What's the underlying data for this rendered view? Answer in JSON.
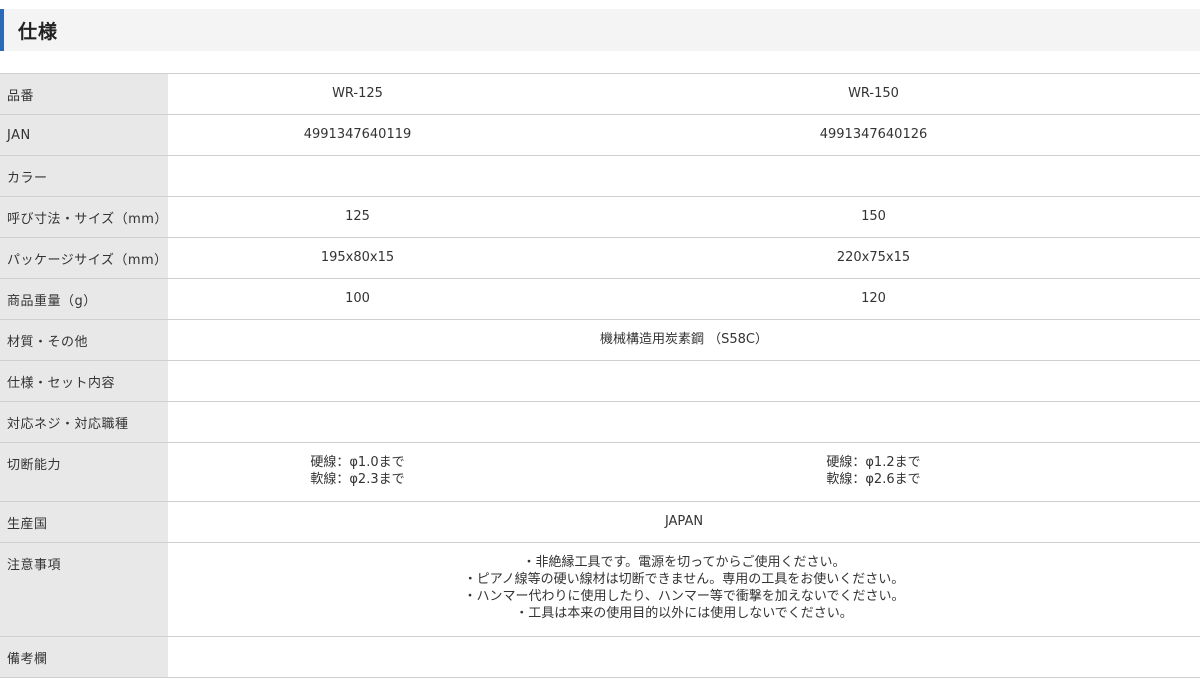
{
  "section": {
    "title": "仕様"
  },
  "columns": [
    "WR-125",
    "WR-150"
  ],
  "rows": {
    "model": {
      "label": "品番",
      "values": [
        "WR-125",
        "WR-150"
      ]
    },
    "jan": {
      "label": "JAN",
      "values": [
        "4991347640119",
        "4991347640126"
      ]
    },
    "color": {
      "label": "カラー",
      "values": [
        "",
        ""
      ]
    },
    "nominal_size": {
      "label": "呼び寸法・サイズ（mm）",
      "values": [
        "125",
        "150"
      ]
    },
    "package_size": {
      "label": "パッケージサイズ（mm）",
      "values": [
        "195x80x15",
        "220x75x15"
      ]
    },
    "weight": {
      "label": "商品重量（g）",
      "values": [
        "100",
        "120"
      ]
    },
    "material": {
      "label": "材質・その他",
      "value": "機械構造用炭素鋼 （S58C）"
    },
    "spec_set": {
      "label": "仕様・セット内容",
      "value": ""
    },
    "compat": {
      "label": "対応ネジ・対応職種",
      "value": ""
    },
    "cutting": {
      "label": "切断能力",
      "values": [
        [
          "硬線：φ1.0まで",
          "軟線：φ2.3まで"
        ],
        [
          "硬線：φ1.2まで",
          "軟線：φ2.6まで"
        ]
      ]
    },
    "origin": {
      "label": "生産国",
      "value": "JAPAN"
    },
    "cautions": {
      "label": "注意事項",
      "lines": [
        "・非絶縁工具です。電源を切ってからご使用ください。",
        "・ピアノ線等の硬い線材は切断できません。専用の工具をお使いください。",
        "・ハンマー代わりに使用したり、ハンマー等で衝撃を加えないでください。",
        "・工具は本来の使用目的以外には使用しないでください。"
      ]
    },
    "remarks": {
      "label": "備考欄",
      "value": ""
    }
  }
}
